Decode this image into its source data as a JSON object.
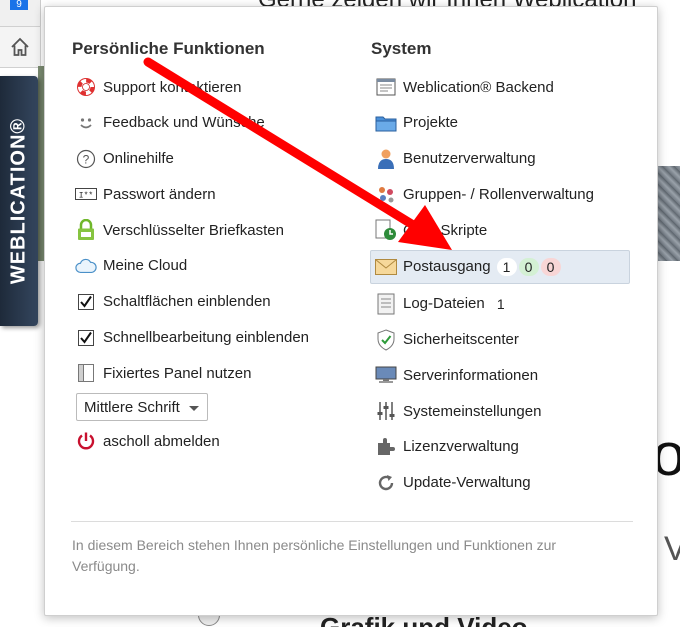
{
  "background": {
    "heading": "Gerne zeigen wir Ihnen Weblication",
    "badge": "9",
    "brand": "WEBLICATION®",
    "big_letter": "o",
    "small_letter": "V",
    "bottom_text": "Grafik und Video"
  },
  "left": {
    "title": "Persönliche Funktionen",
    "items": [
      {
        "label": "Support kontaktieren",
        "icon": "lifebuoy-icon"
      },
      {
        "label": "Feedback und Wünsche",
        "icon": "smiley-icon"
      },
      {
        "label": "Onlinehilfe",
        "icon": "help-icon"
      },
      {
        "label": "Passwort ändern",
        "icon": "password-icon"
      },
      {
        "label": "Verschlüsselter Briefkasten",
        "icon": "lock-icon"
      },
      {
        "label": "Meine Cloud",
        "icon": "cloud-icon"
      },
      {
        "label": "Schaltflächen einblenden",
        "icon": "checkbox-icon"
      },
      {
        "label": "Schnellbearbeitung einblenden",
        "icon": "checkbox-icon"
      },
      {
        "label": "Fixiertes Panel nutzen",
        "icon": "panel-icon"
      }
    ],
    "font_select": "Mittlere Schrift",
    "logout": "ascholl abmelden"
  },
  "right": {
    "title": "System",
    "items": [
      {
        "label": "Weblication® Backend",
        "icon": "backend-icon"
      },
      {
        "label": "Projekte",
        "icon": "folder-icon"
      },
      {
        "label": "Benutzerverwaltung",
        "icon": "user-icon"
      },
      {
        "label": "Gruppen- / Rollenverwaltung",
        "icon": "group-icon"
      },
      {
        "label": "Cron-Skripte",
        "icon": "clock-icon"
      },
      {
        "label": "Postausgang",
        "icon": "mail-icon",
        "counts": [
          "1",
          "0",
          "0"
        ]
      },
      {
        "label": "Log-Dateien",
        "icon": "log-icon",
        "counts": [
          "1"
        ]
      },
      {
        "label": "Sicherheitscenter",
        "icon": "shield-icon"
      },
      {
        "label": "Serverinformationen",
        "icon": "monitor-icon"
      },
      {
        "label": "Systemeinstellungen",
        "icon": "sliders-icon"
      },
      {
        "label": "Lizenzverwaltung",
        "icon": "puzzle-icon"
      },
      {
        "label": "Update-Verwaltung",
        "icon": "refresh-icon"
      }
    ]
  },
  "footer": "In diesem Bereich stehen Ihnen persönliche Einstellungen und Funktionen zur Verfügung.",
  "colors": {
    "arrow": "#ff0000",
    "highlight": "#e4ebf3",
    "brand_bg": "#1e2a3a"
  }
}
